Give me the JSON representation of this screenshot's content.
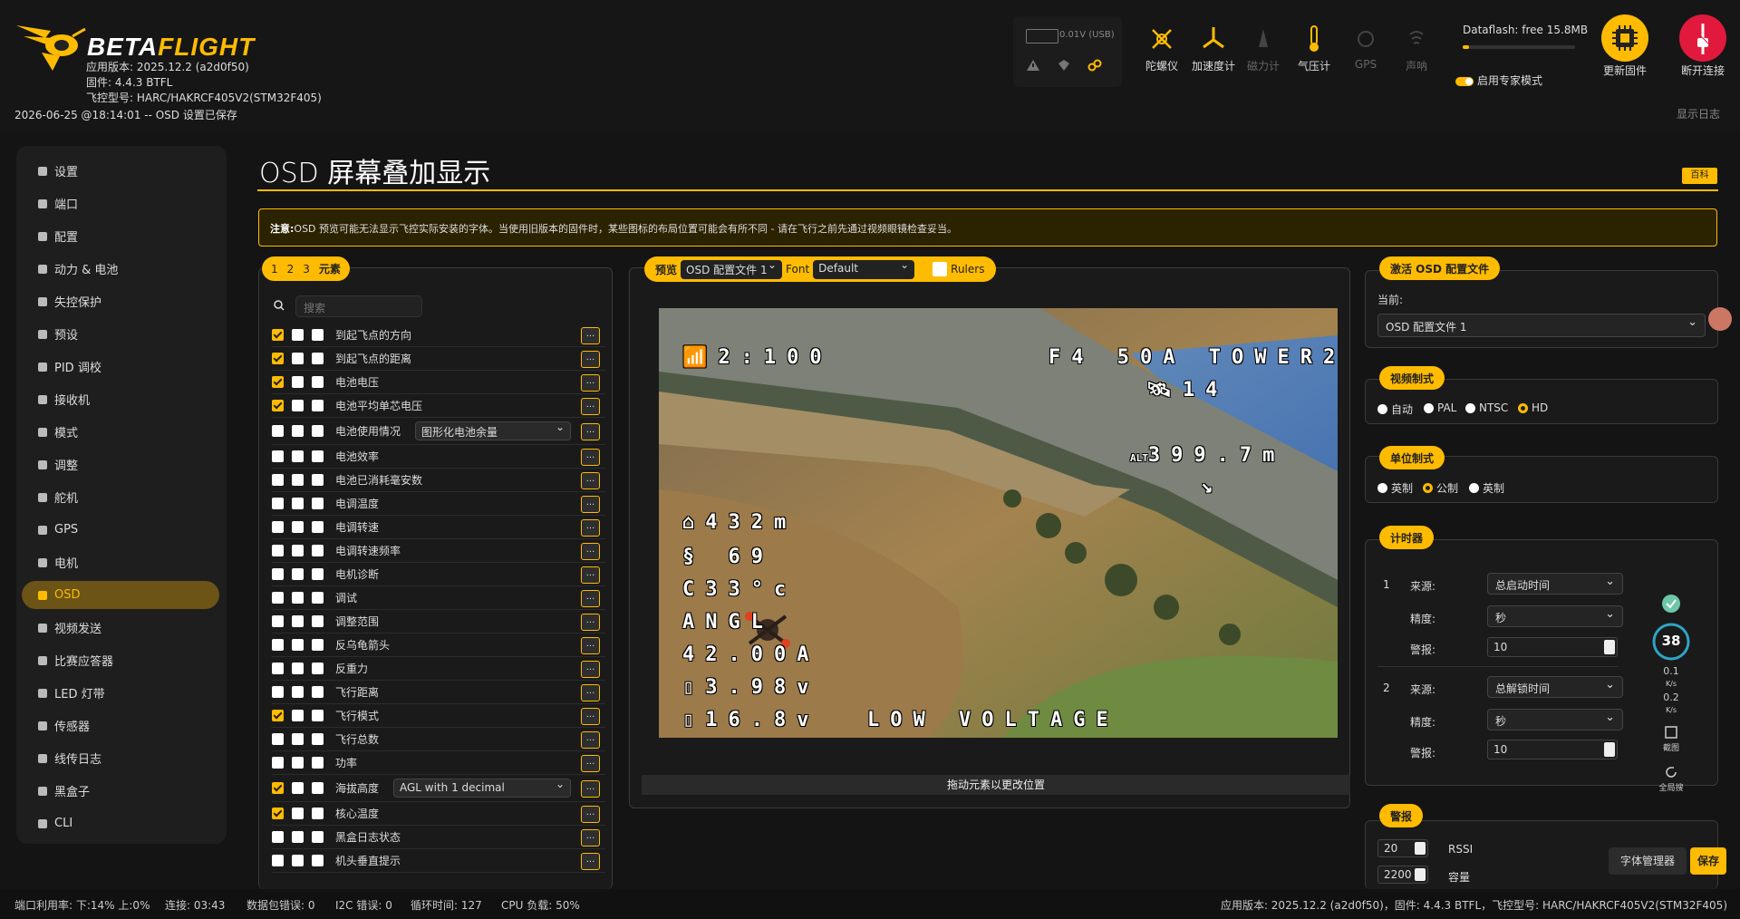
{
  "header": {
    "brand_a": "BETA",
    "brand_b": "FLIGHT",
    "app_version": "应用版本: 2025.12.2 (a2d0f50)",
    "firmware": "固件: 4.4.3 BTFL",
    "board": "飞控型号: HARC/HAKRCF405V2(STM32F405)",
    "status_line": "2026-06-25 @18:14:01 -- OSD 设置已保存",
    "battery_text": "0.01V (USB)",
    "sensors": [
      {
        "label": "陀螺仪",
        "icon": "gyro-icon"
      },
      {
        "label": "加速度计",
        "icon": "accel-icon"
      },
      {
        "label": "磁力计",
        "icon": "mag-icon"
      },
      {
        "label": "气压计",
        "icon": "baro-icon"
      },
      {
        "label": "GPS",
        "icon": "gps-icon"
      },
      {
        "label": "声呐",
        "icon": "sonar-icon"
      }
    ],
    "dataflash": "Dataflash: free 15.8MB",
    "dataflash_used_fraction": 0.06,
    "expert_mode": "启用专家模式",
    "update_firmware": "更新固件",
    "disconnect": "断开连接",
    "show_log": "显示日志"
  },
  "sidebar": {
    "items": [
      {
        "label": "设置",
        "icon": "wrench-icon"
      },
      {
        "label": "端口",
        "icon": "plug-icon"
      },
      {
        "label": "配置",
        "icon": "gear-icon"
      },
      {
        "label": "动力 & 电池",
        "icon": "battery-icon"
      },
      {
        "label": "失控保护",
        "icon": "failsafe-icon"
      },
      {
        "label": "预设",
        "icon": "presets-icon"
      },
      {
        "label": "PID 调校",
        "icon": "pid-icon"
      },
      {
        "label": "接收机",
        "icon": "receiver-icon"
      },
      {
        "label": "模式",
        "icon": "modes-icon"
      },
      {
        "label": "调整",
        "icon": "adjust-icon"
      },
      {
        "label": "舵机",
        "icon": "servo-icon"
      },
      {
        "label": "GPS",
        "icon": "gps-icon"
      },
      {
        "label": "电机",
        "icon": "motor-icon"
      },
      {
        "label": "OSD",
        "icon": "osd-icon"
      },
      {
        "label": "视频发送",
        "icon": "vtx-icon"
      },
      {
        "label": "比赛应答器",
        "icon": "transponder-icon"
      },
      {
        "label": "LED 灯带",
        "icon": "led-icon"
      },
      {
        "label": "传感器",
        "icon": "sensors-icon"
      },
      {
        "label": "线传日志",
        "icon": "tethered-log-icon"
      },
      {
        "label": "黑盒子",
        "icon": "blackbox-icon"
      },
      {
        "label": "CLI",
        "icon": "cli-icon"
      }
    ],
    "active_index": 13
  },
  "page": {
    "title": "OSD 屏幕叠加显示",
    "wiki": "百科",
    "note_bold": "注意:",
    "note": "OSD 预览可能无法显示飞控实际安装的字体。当使用旧版本的固件时，某些图标的布局位置可能会有所不同 - 请在飞行之前先通过视频眼镜检查妥当。"
  },
  "elements": {
    "tab_1": "1",
    "tab_2": "2",
    "tab_3": "3",
    "tab_label": "元素",
    "search_placeholder": "搜索",
    "rows": [
      {
        "label": "到起飞点的方向",
        "c": [
          true,
          false,
          false
        ]
      },
      {
        "label": "到起飞点的距离",
        "c": [
          true,
          false,
          false
        ]
      },
      {
        "label": "电池电压",
        "c": [
          true,
          false,
          false
        ]
      },
      {
        "label": "电池平均单芯电压",
        "c": [
          true,
          false,
          false
        ]
      },
      {
        "label": "电池使用情况",
        "c": [
          false,
          false,
          false
        ],
        "select": "图形化电池余量"
      },
      {
        "label": "电池效率",
        "c": [
          false,
          false,
          false
        ]
      },
      {
        "label": "电池已消耗毫安数",
        "c": [
          false,
          false,
          false
        ]
      },
      {
        "label": "电调温度",
        "c": [
          false,
          false,
          false
        ]
      },
      {
        "label": "电调转速",
        "c": [
          false,
          false,
          false
        ]
      },
      {
        "label": "电调转速频率",
        "c": [
          false,
          false,
          false
        ]
      },
      {
        "label": "电机诊断",
        "c": [
          false,
          false,
          false
        ]
      },
      {
        "label": "调试",
        "c": [
          false,
          false,
          false
        ]
      },
      {
        "label": "调整范围",
        "c": [
          false,
          false,
          false
        ]
      },
      {
        "label": "反乌龟箭头",
        "c": [
          false,
          false,
          false
        ]
      },
      {
        "label": "反重力",
        "c": [
          false,
          false,
          false
        ]
      },
      {
        "label": "飞行距离",
        "c": [
          false,
          false,
          false
        ]
      },
      {
        "label": "飞行模式",
        "c": [
          true,
          false,
          false
        ]
      },
      {
        "label": "飞行总数",
        "c": [
          false,
          false,
          false
        ]
      },
      {
        "label": "功率",
        "c": [
          false,
          false,
          false
        ]
      },
      {
        "label": "海拔高度",
        "c": [
          true,
          false,
          false
        ],
        "select": "AGL with 1 decimal"
      },
      {
        "label": "核心温度",
        "c": [
          true,
          false,
          false
        ]
      },
      {
        "label": "黑盒日志状态",
        "c": [
          false,
          false,
          false
        ]
      },
      {
        "label": "机头垂直提示",
        "c": [
          false,
          false,
          false
        ]
      }
    ],
    "more_label": "..."
  },
  "preview": {
    "label": "预览",
    "profile": "OSD 配置文件 1",
    "font_label": "Font",
    "font": "Default",
    "rulers": "Rulers",
    "drag_hint": "拖动元素以更改位置",
    "osd": {
      "link": "2:100",
      "craft": "F4 50A TOWER2",
      "sats": "14",
      "alt": "399.7m",
      "home_dist": "432m",
      "rssi": "69",
      "temp": "33°c",
      "angl": "ANGL",
      "amps": "42.00A",
      "cell": "3.98v",
      "voltage": "16.8v",
      "warning": "LOW VOLTAGE"
    }
  },
  "right": {
    "active_profile_title": "激活 OSD 配置文件",
    "current_label": "当前:",
    "current_value": "OSD 配置文件 1",
    "video_title": "视频制式",
    "video_options": [
      "自动",
      "PAL",
      "NTSC",
      "HD"
    ],
    "video_selected": 3,
    "units_title": "单位制式",
    "unit_options": [
      "英制",
      "公制",
      "英制"
    ],
    "unit_selected": 1,
    "timers_title": "计时器",
    "timer1": {
      "num": "1",
      "src_label": "来源:",
      "src": "总启动时间",
      "prec_label": "精度:",
      "prec": "秒",
      "alarm_label": "警报:",
      "alarm": "10"
    },
    "timer2": {
      "num": "2",
      "src_label": "来源:",
      "src": "总解锁时间",
      "prec_label": "精度:",
      "prec": "秒",
      "alarm_label": "警报:",
      "alarm": "10"
    },
    "alarms_title": "警报",
    "alarm_rssi_val": "20",
    "alarm_rssi": "RSSI",
    "alarm_cap_val": "2200",
    "alarm_cap": "容量"
  },
  "stats_widget": {
    "value": "38",
    "up": "0.1",
    "up_unit": "K/s",
    "down": "0.2",
    "down_unit": "K/s",
    "shot": "截图",
    "full": "全局搜"
  },
  "buttons": {
    "font_manager": "字体管理器",
    "save": "保存"
  },
  "footer": {
    "port_util": "端口利用率: 下:14% 上:0%",
    "connection": "连接: 03:43",
    "packet_err": "数据包错误: 0",
    "i2c_err": "I2C 错误: 0",
    "cycle": "循环时间: 127",
    "cpu": "CPU 负载: 50%",
    "version": "应用版本: 2025.12.2 (a2d0f50)，固件: 4.4.3 BTFL，飞控型号: HARC/HAKRCF405V2(STM32F405)"
  },
  "colors": {
    "accent": "#ffbb00",
    "bg": "#141414",
    "panel": "#1a1a1a"
  }
}
